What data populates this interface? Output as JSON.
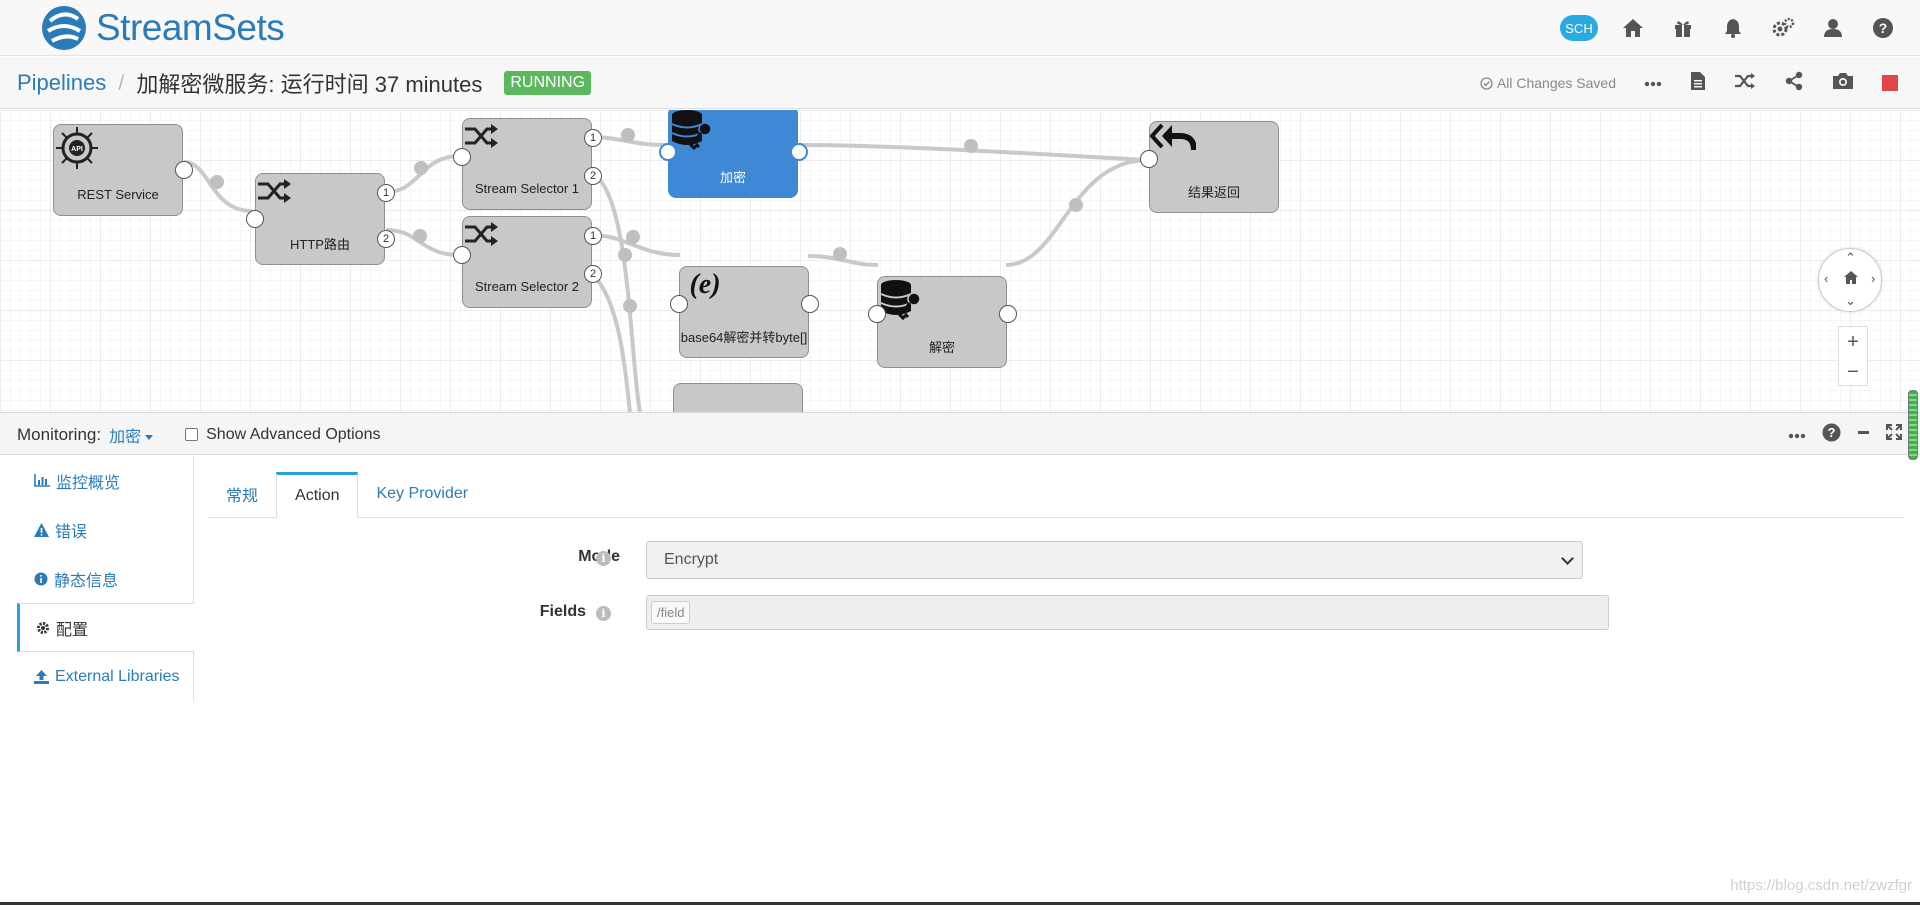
{
  "app": {
    "logo_text": "StreamSets",
    "brand_color": "#2b7bb9"
  },
  "topbar": {
    "sch_label": "SCH",
    "icons": [
      "sch-cloud-icon",
      "home-icon",
      "gift-icon",
      "bell-icon",
      "gears-icon",
      "user-icon",
      "help-icon"
    ]
  },
  "breadcrumb": {
    "root": "Pipelines",
    "separator": "/",
    "pipeline_title": "加解密微服务:  运行时间  37 minutes",
    "status": "RUNNING",
    "status_color": "#5cb85c",
    "saved_text": "All Changes Saved"
  },
  "canvas": {
    "stages": [
      {
        "name": "REST Service",
        "icon": "api-gear-icon"
      },
      {
        "name": "HTTP路由",
        "icon": "stream-selector-icon"
      },
      {
        "name": "Stream Selector 1",
        "icon": "stream-selector-icon"
      },
      {
        "name": "Stream Selector 2",
        "icon": "stream-selector-icon"
      },
      {
        "name": "加密",
        "icon": "database-key-icon",
        "selected": true
      },
      {
        "name": "base64解密并转byte[]",
        "icon": "expression-icon"
      },
      {
        "name": "解密",
        "icon": "database-key-icon"
      },
      {
        "name": "结果返回",
        "icon": "reply-all-icon"
      }
    ],
    "port_labels": [
      "1",
      "2"
    ],
    "selected_color": "#3e88d6"
  },
  "monitoring": {
    "label": "Monitoring:",
    "selected_stage": "加密",
    "advanced_label": "Show Advanced Options",
    "advanced_checked": false
  },
  "sidenav": {
    "items": [
      {
        "label": "监控概览",
        "icon": "bar-chart-icon"
      },
      {
        "label": "错误",
        "icon": "warning-icon"
      },
      {
        "label": "静态信息",
        "icon": "info-circle-icon"
      },
      {
        "label": "配置",
        "icon": "gear-icon",
        "active": true
      },
      {
        "label": "External Libraries",
        "icon": "upload-icon"
      }
    ]
  },
  "tabs": [
    {
      "label": "常规"
    },
    {
      "label": "Action",
      "active": true
    },
    {
      "label": "Key Provider"
    }
  ],
  "form": {
    "mode_label": "Mode",
    "mode_value": "Encrypt",
    "fields_label": "Fields",
    "fields_tag": "/field"
  },
  "watermark": "https://blog.csdn.net/zwzfgr"
}
